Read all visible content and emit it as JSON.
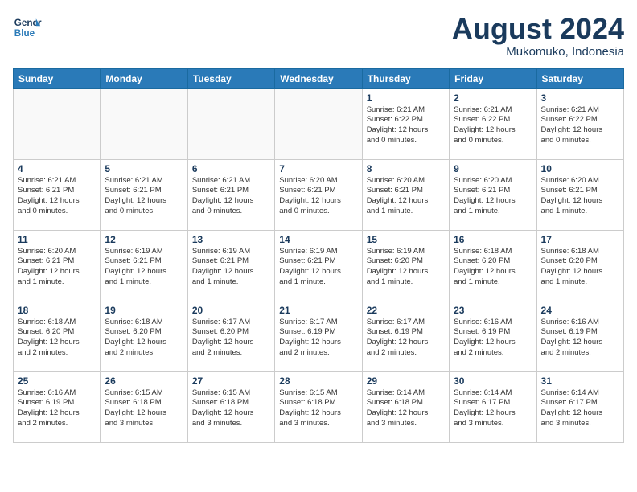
{
  "header": {
    "logo_line1": "General",
    "logo_line2": "Blue",
    "month_title": "August 2024",
    "location": "Mukomuko, Indonesia"
  },
  "weekdays": [
    "Sunday",
    "Monday",
    "Tuesday",
    "Wednesday",
    "Thursday",
    "Friday",
    "Saturday"
  ],
  "weeks": [
    [
      {
        "day": "",
        "info": ""
      },
      {
        "day": "",
        "info": ""
      },
      {
        "day": "",
        "info": ""
      },
      {
        "day": "",
        "info": ""
      },
      {
        "day": "1",
        "info": "Sunrise: 6:21 AM\nSunset: 6:22 PM\nDaylight: 12 hours\nand 0 minutes."
      },
      {
        "day": "2",
        "info": "Sunrise: 6:21 AM\nSunset: 6:22 PM\nDaylight: 12 hours\nand 0 minutes."
      },
      {
        "day": "3",
        "info": "Sunrise: 6:21 AM\nSunset: 6:22 PM\nDaylight: 12 hours\nand 0 minutes."
      }
    ],
    [
      {
        "day": "4",
        "info": "Sunrise: 6:21 AM\nSunset: 6:21 PM\nDaylight: 12 hours\nand 0 minutes."
      },
      {
        "day": "5",
        "info": "Sunrise: 6:21 AM\nSunset: 6:21 PM\nDaylight: 12 hours\nand 0 minutes."
      },
      {
        "day": "6",
        "info": "Sunrise: 6:21 AM\nSunset: 6:21 PM\nDaylight: 12 hours\nand 0 minutes."
      },
      {
        "day": "7",
        "info": "Sunrise: 6:20 AM\nSunset: 6:21 PM\nDaylight: 12 hours\nand 0 minutes."
      },
      {
        "day": "8",
        "info": "Sunrise: 6:20 AM\nSunset: 6:21 PM\nDaylight: 12 hours\nand 1 minute."
      },
      {
        "day": "9",
        "info": "Sunrise: 6:20 AM\nSunset: 6:21 PM\nDaylight: 12 hours\nand 1 minute."
      },
      {
        "day": "10",
        "info": "Sunrise: 6:20 AM\nSunset: 6:21 PM\nDaylight: 12 hours\nand 1 minute."
      }
    ],
    [
      {
        "day": "11",
        "info": "Sunrise: 6:20 AM\nSunset: 6:21 PM\nDaylight: 12 hours\nand 1 minute."
      },
      {
        "day": "12",
        "info": "Sunrise: 6:19 AM\nSunset: 6:21 PM\nDaylight: 12 hours\nand 1 minute."
      },
      {
        "day": "13",
        "info": "Sunrise: 6:19 AM\nSunset: 6:21 PM\nDaylight: 12 hours\nand 1 minute."
      },
      {
        "day": "14",
        "info": "Sunrise: 6:19 AM\nSunset: 6:21 PM\nDaylight: 12 hours\nand 1 minute."
      },
      {
        "day": "15",
        "info": "Sunrise: 6:19 AM\nSunset: 6:20 PM\nDaylight: 12 hours\nand 1 minute."
      },
      {
        "day": "16",
        "info": "Sunrise: 6:18 AM\nSunset: 6:20 PM\nDaylight: 12 hours\nand 1 minute."
      },
      {
        "day": "17",
        "info": "Sunrise: 6:18 AM\nSunset: 6:20 PM\nDaylight: 12 hours\nand 1 minute."
      }
    ],
    [
      {
        "day": "18",
        "info": "Sunrise: 6:18 AM\nSunset: 6:20 PM\nDaylight: 12 hours\nand 2 minutes."
      },
      {
        "day": "19",
        "info": "Sunrise: 6:18 AM\nSunset: 6:20 PM\nDaylight: 12 hours\nand 2 minutes."
      },
      {
        "day": "20",
        "info": "Sunrise: 6:17 AM\nSunset: 6:20 PM\nDaylight: 12 hours\nand 2 minutes."
      },
      {
        "day": "21",
        "info": "Sunrise: 6:17 AM\nSunset: 6:19 PM\nDaylight: 12 hours\nand 2 minutes."
      },
      {
        "day": "22",
        "info": "Sunrise: 6:17 AM\nSunset: 6:19 PM\nDaylight: 12 hours\nand 2 minutes."
      },
      {
        "day": "23",
        "info": "Sunrise: 6:16 AM\nSunset: 6:19 PM\nDaylight: 12 hours\nand 2 minutes."
      },
      {
        "day": "24",
        "info": "Sunrise: 6:16 AM\nSunset: 6:19 PM\nDaylight: 12 hours\nand 2 minutes."
      }
    ],
    [
      {
        "day": "25",
        "info": "Sunrise: 6:16 AM\nSunset: 6:19 PM\nDaylight: 12 hours\nand 2 minutes."
      },
      {
        "day": "26",
        "info": "Sunrise: 6:15 AM\nSunset: 6:18 PM\nDaylight: 12 hours\nand 3 minutes."
      },
      {
        "day": "27",
        "info": "Sunrise: 6:15 AM\nSunset: 6:18 PM\nDaylight: 12 hours\nand 3 minutes."
      },
      {
        "day": "28",
        "info": "Sunrise: 6:15 AM\nSunset: 6:18 PM\nDaylight: 12 hours\nand 3 minutes."
      },
      {
        "day": "29",
        "info": "Sunrise: 6:14 AM\nSunset: 6:18 PM\nDaylight: 12 hours\nand 3 minutes."
      },
      {
        "day": "30",
        "info": "Sunrise: 6:14 AM\nSunset: 6:17 PM\nDaylight: 12 hours\nand 3 minutes."
      },
      {
        "day": "31",
        "info": "Sunrise: 6:14 AM\nSunset: 6:17 PM\nDaylight: 12 hours\nand 3 minutes."
      }
    ]
  ]
}
